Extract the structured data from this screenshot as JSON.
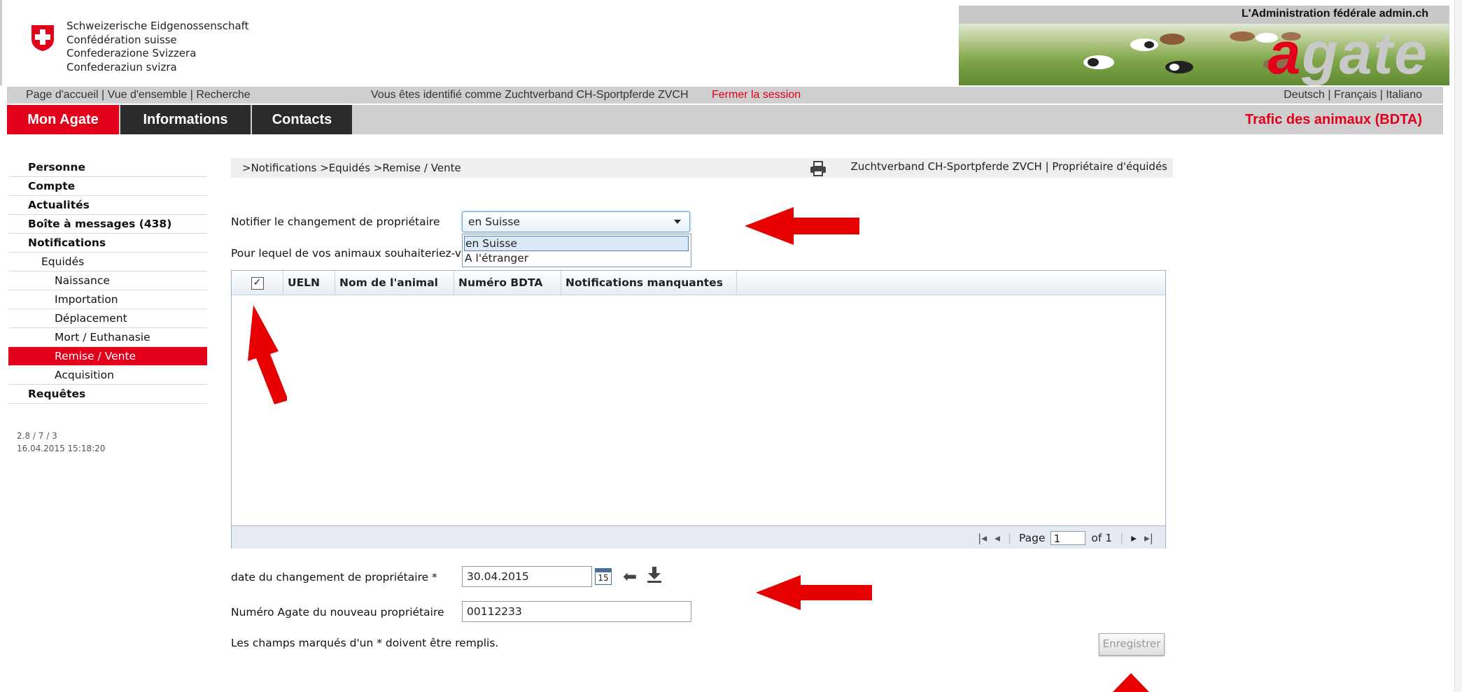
{
  "header": {
    "fed_names": [
      "Schweizerische Eidgenossenschaft",
      "Confédération suisse",
      "Confederazione Svizzera",
      "Confederaziun svizra"
    ],
    "admin_text": "L'Administration fédérale admin.ch",
    "logo_a": "a",
    "logo_rest": "gate"
  },
  "topnav": {
    "home": "Page d'accueil",
    "overview": "Vue d'ensemble",
    "search": "Recherche",
    "identified": "Vous êtes identifié comme Zuchtverband CH-Sportpferde ZVCH",
    "logout": "Fermer la session",
    "lang_de": "Deutsch",
    "lang_fr": "Français",
    "lang_it": "Italiano"
  },
  "tabs": {
    "mon_agate": "Mon Agate",
    "informations": "Informations",
    "contacts": "Contacts",
    "trafic": "Trafic des animaux (BDTA)"
  },
  "sidebar": {
    "items": [
      {
        "label": "Personne"
      },
      {
        "label": "Compte"
      },
      {
        "label": "Actualités"
      },
      {
        "label": "Boîte à messages (438)"
      },
      {
        "label": "Notifications"
      },
      {
        "label": "Equidés"
      },
      {
        "label": "Naissance"
      },
      {
        "label": "Importation"
      },
      {
        "label": "Déplacement"
      },
      {
        "label": "Mort / Euthanasie"
      },
      {
        "label": "Remise / Vente"
      },
      {
        "label": "Acquisition"
      },
      {
        "label": "Requêtes"
      }
    ],
    "version": "2.8 / 7 / 3",
    "timestamp": "16.04.2015 15:18:20"
  },
  "content": {
    "breadcrumb": ">Notifications >Equidés >Remise / Vente",
    "owner_info": "Zuchtverband CH-Sportpferde ZVCH | Propriétaire d'équidés",
    "notify_label": "Notifier le changement de propriétaire",
    "select_value": "en Suisse",
    "options": [
      "en Suisse",
      "A l'étranger"
    ],
    "animals_question": "Pour lequel de vos animaux souhaiteriez-vo",
    "date_label": "date du changement de propriétaire *",
    "date_value": "30.04.2015",
    "calendar_day": "15",
    "agate_label": "Numéro Agate du nouveau propriétaire",
    "agate_value": "00112233",
    "required_note": "Les champs marqués d'un * doivent être remplis.",
    "save_label": "Enregistrer"
  },
  "grid": {
    "checkbox_mark": "✓",
    "columns": [
      "UELN",
      "Nom de l'animal",
      "Numéro BDTA",
      "Notifications manquantes"
    ],
    "pager": {
      "page_label": "Page",
      "page_value": "1",
      "of_label": "of 1"
    }
  },
  "colors": {
    "accent_red": "#e2001a",
    "tab_dark": "#2b2b2b",
    "nav_grey": "#cfcfcf"
  }
}
